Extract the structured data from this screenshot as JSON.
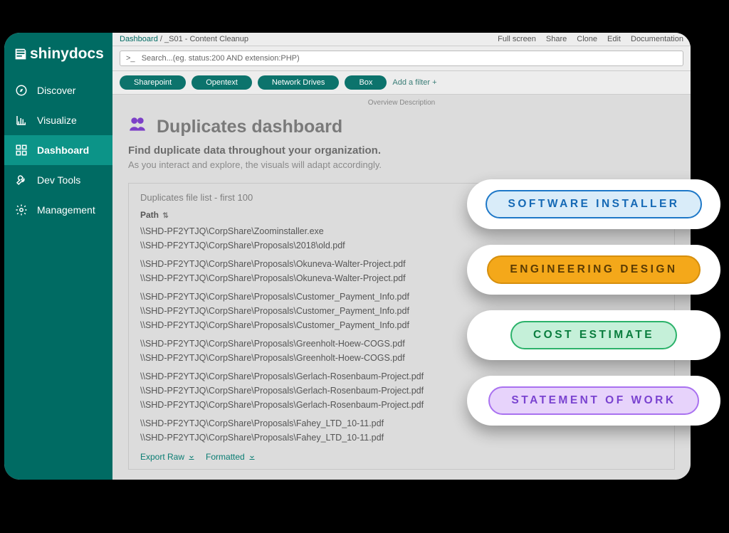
{
  "brand": "shinydocs",
  "sidebar": {
    "items": [
      {
        "label": "Discover"
      },
      {
        "label": "Visualize"
      },
      {
        "label": "Dashboard"
      },
      {
        "label": "Dev Tools"
      },
      {
        "label": "Management"
      }
    ]
  },
  "topbar": {
    "breadcrumb_root": "Dashboard",
    "breadcrumb_current": "_S01 - Content Cleanup",
    "actions": [
      "Full screen",
      "Share",
      "Clone",
      "Edit",
      "Documentation"
    ]
  },
  "search": {
    "prefix": ">_",
    "placeholder": "Search...(eg. status:200 AND extension:PHP)"
  },
  "filters": {
    "pills": [
      "Sharepoint",
      "Opentext",
      "Network Drives",
      "Box"
    ],
    "add_label": "Add a filter",
    "plus": "+"
  },
  "overview_label": "Overview Description",
  "header": {
    "title": "Duplicates dashboard",
    "subtitle": "Find duplicate data throughout your organization.",
    "description": "As you interact and explore, the visuals will adapt accordingly."
  },
  "panel": {
    "title": "Duplicates file list - first 100",
    "column": "Path",
    "rows": [
      "\\\\SHD-PF2YTJQ\\CorpShare\\Zoominstaller.exe",
      "\\\\SHD-PF2YTJQ\\CorpShare\\Proposals\\2018\\old.pdf",
      "\\\\SHD-PF2YTJQ\\CorpShare\\Proposals\\Okuneva-Walter-Project.pdf",
      "\\\\SHD-PF2YTJQ\\CorpShare\\Proposals\\Okuneva-Walter-Project.pdf",
      "\\\\SHD-PF2YTJQ\\CorpShare\\Proposals\\Customer_Payment_Info.pdf",
      "\\\\SHD-PF2YTJQ\\CorpShare\\Proposals\\Customer_Payment_Info.pdf",
      "\\\\SHD-PF2YTJQ\\CorpShare\\Proposals\\Customer_Payment_Info.pdf",
      "\\\\SHD-PF2YTJQ\\CorpShare\\Proposals\\Greenholt-Hoew-COGS.pdf",
      "\\\\SHD-PF2YTJQ\\CorpShare\\Proposals\\Greenholt-Hoew-COGS.pdf",
      "\\\\SHD-PF2YTJQ\\CorpShare\\Proposals\\Gerlach-Rosenbaum-Project.pdf",
      "\\\\SHD-PF2YTJQ\\CorpShare\\Proposals\\Gerlach-Rosenbaum-Project.pdf",
      "\\\\SHD-PF2YTJQ\\CorpShare\\Proposals\\Gerlach-Rosenbaum-Project.pdf",
      "\\\\SHD-PF2YTJQ\\CorpShare\\Proposals\\Fahey_LTD_10-11.pdf",
      "\\\\SHD-PF2YTJQ\\CorpShare\\Proposals\\Fahey_LTD_10-11.pdf"
    ],
    "group_breaks": [
      2,
      4,
      7,
      9,
      12
    ],
    "export_raw": "Export Raw",
    "export_formatted": "Formatted"
  },
  "chips": [
    {
      "label": "SOFTWARE INSTALLER"
    },
    {
      "label": "ENGINEERING DESIGN"
    },
    {
      "label": "COST ESTIMATE"
    },
    {
      "label": "STATEMENT OF WORK"
    }
  ]
}
